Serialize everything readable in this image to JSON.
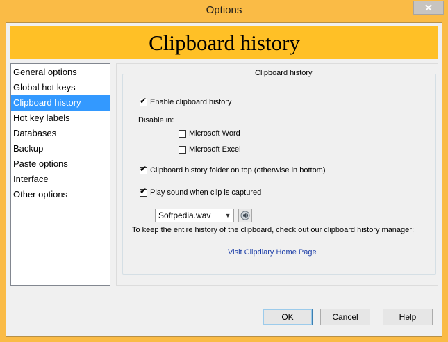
{
  "window": {
    "title": "Options"
  },
  "banner": {
    "title": "Clipboard history"
  },
  "nav": {
    "items": [
      {
        "label": "General options",
        "selected": false
      },
      {
        "label": "Global hot keys",
        "selected": false
      },
      {
        "label": "Clipboard history",
        "selected": true
      },
      {
        "label": "Hot key labels",
        "selected": false
      },
      {
        "label": "Databases",
        "selected": false
      },
      {
        "label": "Backup",
        "selected": false
      },
      {
        "label": "Paste options",
        "selected": false
      },
      {
        "label": "Interface",
        "selected": false
      },
      {
        "label": "Other options",
        "selected": false
      }
    ]
  },
  "group": {
    "legend": "Clipboard history",
    "enable_history": {
      "label": "Enable clipboard history",
      "checked": true
    },
    "disable_in_label": "Disable in:",
    "disable_word": {
      "label": "Microsoft Word",
      "checked": false
    },
    "disable_excel": {
      "label": "Microsoft Excel",
      "checked": false
    },
    "folder_on_top": {
      "label": "Clipboard history folder on top (otherwise in bottom)",
      "checked": true
    },
    "play_sound": {
      "label": "Play sound when clip is captured",
      "checked": true
    },
    "sound_file": {
      "selected": "Softpedia.wav"
    },
    "info_text": "To keep the entire history of the clipboard, check out our clipboard history manager:",
    "link_text": "Visit Clipdiary Home Page"
  },
  "buttons": {
    "ok": "OK",
    "cancel": "Cancel",
    "help": "Help"
  },
  "colors": {
    "frame": "#FABB46",
    "banner": "#FFC026",
    "selection": "#3399FF",
    "link": "#1D3FA8"
  }
}
